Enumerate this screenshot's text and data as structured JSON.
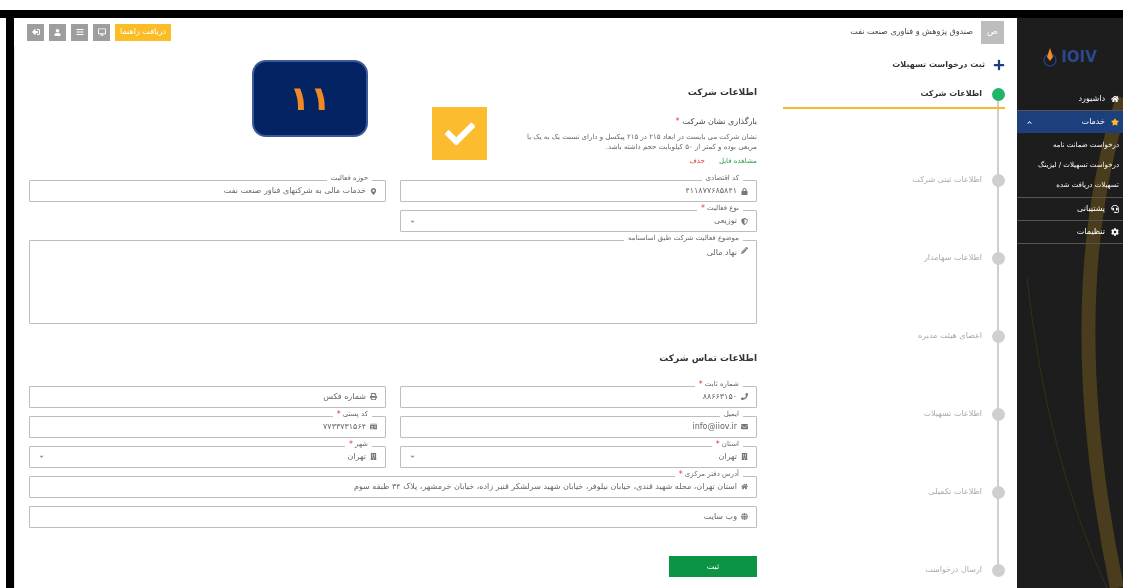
{
  "toolbar": {
    "help_button": "دریافت راهنما"
  },
  "header": {
    "avatar": "ص",
    "organization": "صندوق پژوهش و فناوری صنعت نفت"
  },
  "sidebar": {
    "logo": "IOIV",
    "items": [
      {
        "label": "داشبورد",
        "selected": false,
        "expanded": false
      },
      {
        "label": "خدمات",
        "selected": true,
        "expanded": true,
        "children": [
          "درخواست ضمانت نامه",
          "درخواست تسهیلات / لیزینگ",
          "تسهیلات دریافت شده"
        ]
      },
      {
        "label": "پشتیبانی",
        "selected": false,
        "expanded": false
      },
      {
        "label": "تنظیمات",
        "selected": false,
        "expanded": false
      }
    ]
  },
  "stepper": {
    "title": "ثبت درخواست تسهیلات",
    "steps": [
      {
        "label": "اطلاعات شرکت",
        "selected": true
      },
      {
        "label": "اطلاعات ثبتی شرکت",
        "selected": false
      },
      {
        "label": "اطلاعات سهامدار",
        "selected": false
      },
      {
        "label": "اعضای هیئت مدیره",
        "selected": false
      },
      {
        "label": "اطلاعات تسهیلات",
        "selected": false
      },
      {
        "label": "اطلاعات تکمیلی",
        "selected": false
      },
      {
        "label": "ارسال درخواست",
        "selected": false
      }
    ]
  },
  "company": {
    "title": "اطلاعات شرکت",
    "logo_upload": {
      "label": "بارگذاری نشان شرکت",
      "required_mark": "*",
      "description": "نشان شرکت می بایست در ابعاد ۲۱۵ در ۲۱۵ پیکسل و دارای نسبت یک به یک یا مربعی بوده و کمتر از ۵۰ کیلوبایت حجم داشته باشد.",
      "view_link": "مشاهده فایل",
      "delete_link": "حذف",
      "uploaded": true
    },
    "fields": [
      {
        "kind": "text",
        "label": "کد اقتصادی",
        "value": "۴۱۱۸۷۷۶۸۵۸۴۱"
      },
      {
        "kind": "text",
        "label": "حوزه فعالیت",
        "value": "خدمات مالی به شرکتهای فناور صنعت نفت"
      },
      {
        "kind": "select",
        "label": "نوع فعالیت",
        "required_mark": "*",
        "value": "توزیعی"
      },
      {
        "kind": "textarea",
        "label": "موضوع فعالیت شرکت طبق اساسنامه",
        "value": "نهاد مالی"
      }
    ]
  },
  "contact": {
    "title": "اطلاعات تماس شرکت",
    "fields": [
      {
        "kind": "text",
        "label": "شماره ثابت",
        "required_mark": "*",
        "value": "۸۸۶۶۳۱۵۰"
      },
      {
        "kind": "text",
        "placeholder": "شماره فکس"
      },
      {
        "kind": "text",
        "label": "ایمیل",
        "value": "info@iiov.ir"
      },
      {
        "kind": "text",
        "label": "کد پستی",
        "required_mark": "*",
        "value": "۷۷۳۳۷۳۱۵۶۴"
      },
      {
        "kind": "select",
        "label": "استان",
        "required_mark": "*",
        "value": "تهران"
      },
      {
        "kind": "select",
        "label": "شهر",
        "required_mark": "*",
        "value": "تهران"
      },
      {
        "kind": "wide",
        "label": "آدرس دفتر مرکزی",
        "required_mark": "*",
        "value": "استان تهران، محله شهید قندی، خیابان نیلوفر، خیابان شهید سرلشکر قنبر زاده، خیابان خرمشهر، پلاک ۳۴ طبقه سوم"
      },
      {
        "kind": "wide",
        "placeholder": "وب سایت"
      }
    ]
  },
  "submit_button": "ثبت",
  "overlay_badge": "۱۱"
}
